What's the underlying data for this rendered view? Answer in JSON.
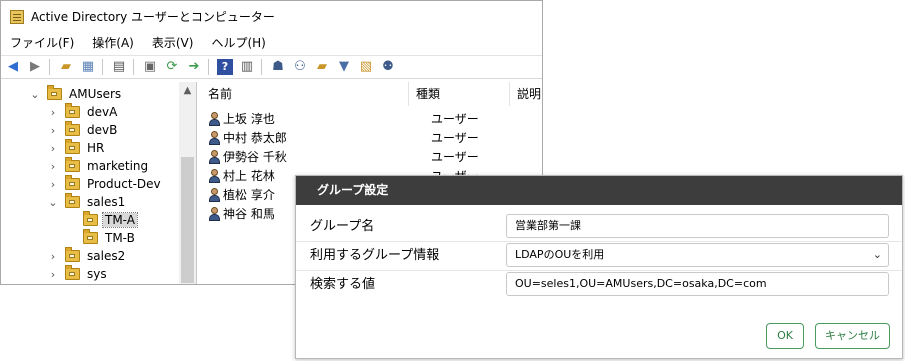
{
  "window": {
    "title": "Active Directory ユーザーとコンピューター",
    "menu": [
      "ファイル(F)",
      "操作(A)",
      "表示(V)",
      "ヘルプ(H)"
    ]
  },
  "toolbar": {
    "icons": [
      "back-arrow-icon",
      "forward-arrow-icon",
      "up-folder-icon",
      "show-console-tree-icon",
      "clipboard-icon",
      "properties-icon",
      "refresh-icon",
      "export-list-icon",
      "help-icon",
      "console-icon",
      "new-user-icon",
      "new-group-icon",
      "new-ou-icon",
      "filter-icon",
      "find-icon",
      "add-to-group-icon"
    ],
    "accent_blue": "#2f6fd0",
    "accent_green": "#3c9a4a"
  },
  "tree": {
    "items": [
      {
        "label": "AMUsers",
        "expanded": true,
        "level": 0
      },
      {
        "label": "devA",
        "expanded": false,
        "level": 1
      },
      {
        "label": "devB",
        "expanded": false,
        "level": 1
      },
      {
        "label": "HR",
        "expanded": false,
        "level": 1
      },
      {
        "label": "marketing",
        "expanded": false,
        "level": 1
      },
      {
        "label": "Product-Dev",
        "expanded": false,
        "level": 1
      },
      {
        "label": "sales1",
        "expanded": true,
        "level": 1
      },
      {
        "label": "TM-A",
        "selected": true,
        "level": 2
      },
      {
        "label": "TM-B",
        "level": 2
      },
      {
        "label": "sales2",
        "expanded": false,
        "level": 1
      },
      {
        "label": "sys",
        "expanded": false,
        "level": 1
      }
    ]
  },
  "list": {
    "columns": [
      "名前",
      "種類",
      "説明"
    ],
    "rows": [
      {
        "name": "上坂 淳也",
        "type": "ユーザー"
      },
      {
        "name": "中村 恭太郎",
        "type": "ユーザー"
      },
      {
        "name": "伊勢谷 千秋",
        "type": "ユーザー"
      },
      {
        "name": "村上 花林",
        "type": "ユーザー"
      },
      {
        "name": "植松 享介",
        "type": ""
      },
      {
        "name": "神谷 和馬",
        "type": ""
      }
    ]
  },
  "dialog": {
    "title": "グループ設定",
    "group_name_label": "グループ名",
    "group_name_value": "営業部第一課",
    "group_info_label": "利用するグループ情報",
    "group_info_value": "LDAPのOUを利用",
    "search_value_label": "検索する値",
    "search_value": "OU=seles1,OU=AMUsers,DC=osaka,DC=com",
    "ok_label": "OK",
    "cancel_label": "キャンセル",
    "header_color": "#3d3d3d",
    "button_color": "#2e7d43"
  }
}
